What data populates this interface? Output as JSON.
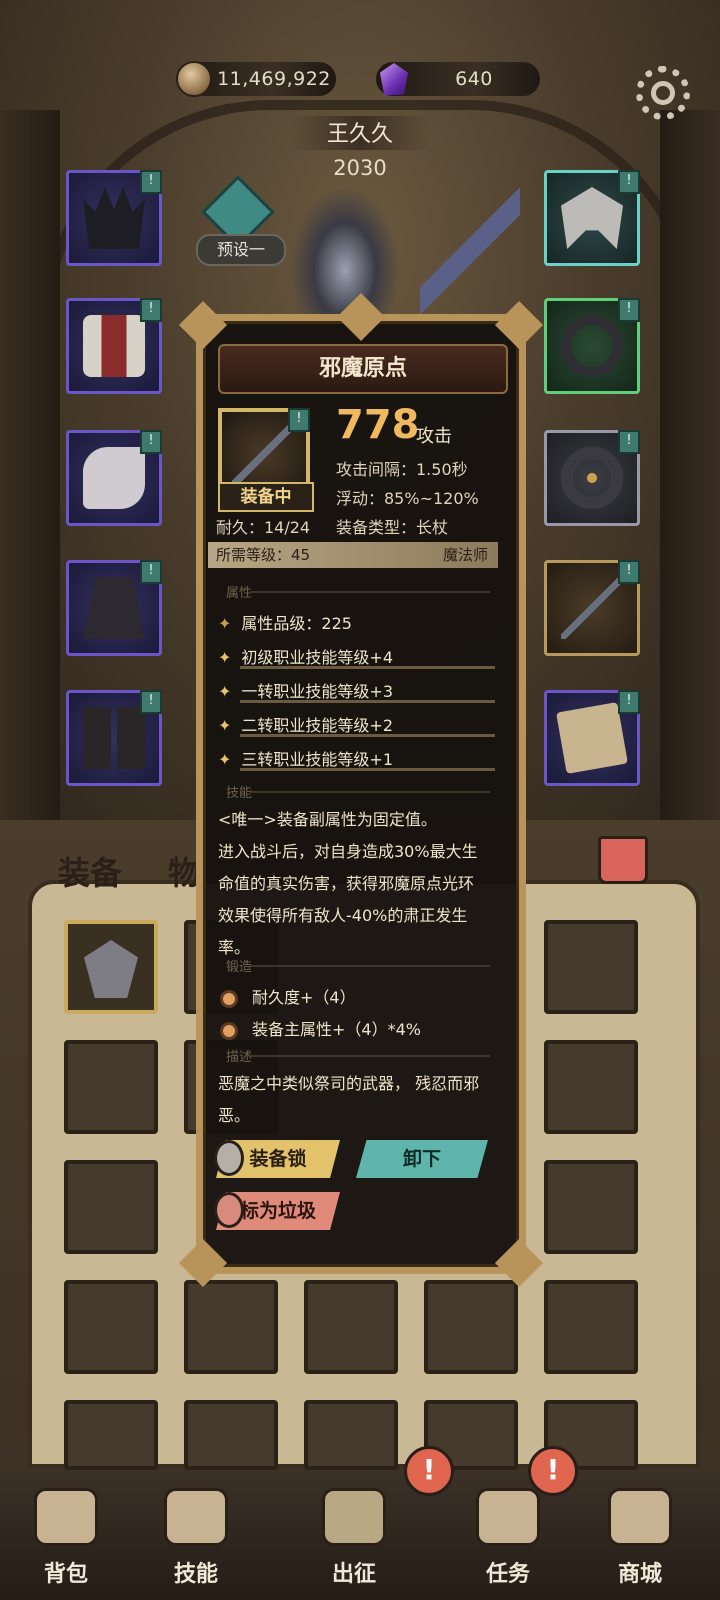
{
  "currency": {
    "gold": "11,469,922",
    "gems": "640",
    "gold_icon": "coin-icon",
    "gem_icon": "purple-gem-icon"
  },
  "player": {
    "name": "王久久",
    "power": "2030",
    "preset_label": "预设一"
  },
  "tabs": {
    "equip": "装备",
    "items": "物"
  },
  "nav": [
    {
      "label": "背包",
      "icon": "backpack-icon"
    },
    {
      "label": "技能",
      "icon": "skillbook-icon"
    },
    {
      "label": "出征",
      "icon": "sword-icon"
    },
    {
      "label": "任务",
      "icon": "scroll-icon"
    },
    {
      "label": "商城",
      "icon": "shop-icon"
    }
  ],
  "alert_glyph": "!",
  "slot_badge": "!",
  "tooltip": {
    "title": "邪魔原点",
    "equipped_label": "装备中",
    "durability": "耐久：14/24",
    "attack_value": "778",
    "attack_unit": "攻击",
    "attack_interval": "攻击间隔：1.50秒",
    "fluctuation": "浮动：85%~120%",
    "equip_type": "装备类型：长杖",
    "required_level": "所需等级：45",
    "class_name": "魔法师",
    "section_attributes": "属性",
    "attr_tier": "属性品级：225",
    "attributes": [
      "初级职业技能等级+4",
      "一转职业技能等级+3",
      "二转职业技能等级+2",
      "三转职业技能等级+1"
    ],
    "attribute_star": "✦",
    "section_skill": "技能",
    "skill_lines": [
      "<唯一>装备副属性为固定值。",
      "进入战斗后，对自身造成30%最大生",
      "命值的真实伤害，获得邪魔原点光环",
      "效果使得所有敌人-40%的肃正发生",
      "率。"
    ],
    "section_forge": "锻造",
    "forge": [
      "耐久度+（4）",
      "装备主属性+（4）*4%"
    ],
    "section_desc": "描述",
    "description_lines": [
      "恶魔之中类似祭司的武器， 残忍而邪",
      "恶。"
    ],
    "lock_button": "装备锁",
    "unequip_button": "卸下",
    "junk_button": "标为垃圾"
  }
}
